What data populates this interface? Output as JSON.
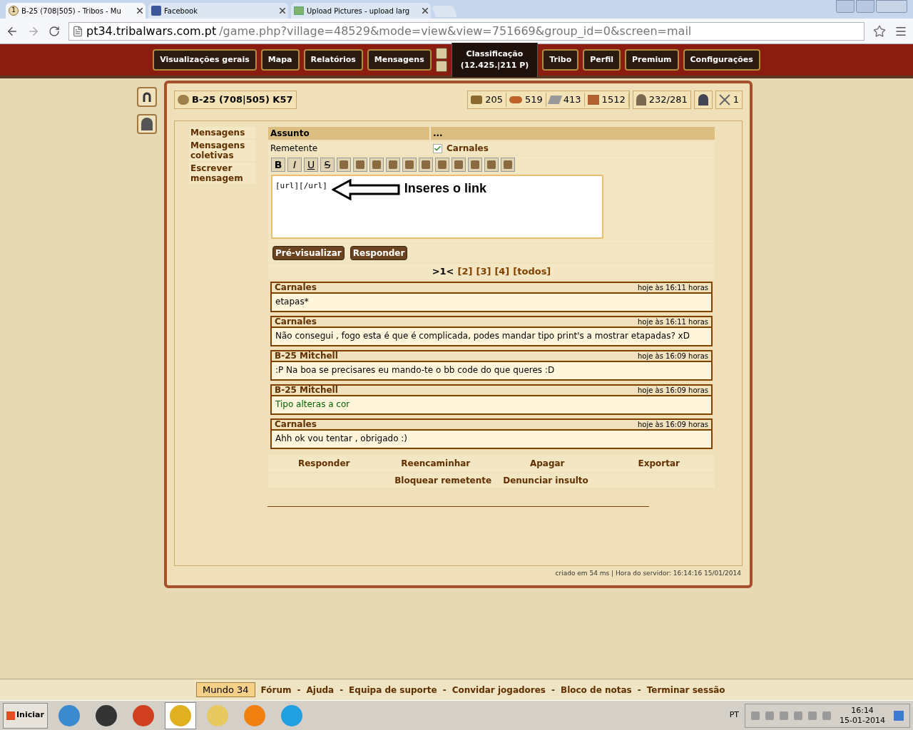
{
  "browser": {
    "tabs": [
      {
        "title": "B-25 (708|505) - Tribos - Mu",
        "favicon_text": "1",
        "selected": true
      },
      {
        "title": "Facebook",
        "selected": false
      },
      {
        "title": "Upload Pictures - upload larg",
        "selected": false
      }
    ],
    "url_host": "pt34.tribalwars.com.pt",
    "url_path": "/game.php?village=48529&mode=view&view=751669&group_id=0&screen=mail"
  },
  "game_nav": {
    "items_left": [
      "Visualizações gerais",
      "Mapa",
      "Relatórios",
      "Mensagens"
    ],
    "ranking": {
      "label": "Classificação",
      "value": "(12.425.|211 P)"
    },
    "items_right": [
      "Tribo",
      "Perfil",
      "Premium",
      "Configurações"
    ]
  },
  "village": {
    "name": "B-25 (708|505) K57"
  },
  "resources": {
    "wood": "205",
    "clay": "519",
    "iron": "413",
    "storage": "1512",
    "population": "232/281",
    "units": "1"
  },
  "sidebar": {
    "items": [
      "Mensagens",
      "Mensagens coletivas",
      "Escrever mensagem"
    ]
  },
  "message_table": {
    "header": [
      "Assunto",
      "..."
    ],
    "sender_label": "Remetente",
    "sender": {
      "name": "Carnales",
      "checked": true
    }
  },
  "editor": {
    "format_buttons": [
      "B",
      "I",
      "U",
      "S"
    ],
    "value": "[url][/url]",
    "annotation": "Inseres o link"
  },
  "buttons": [
    "Pré-visualizar",
    "Responder"
  ],
  "pagination": [
    {
      "label": ">1<",
      "selected": true
    },
    {
      "label": "[2]",
      "selected": false
    },
    {
      "label": "[3]",
      "selected": false
    },
    {
      "label": "[4]",
      "selected": false
    },
    {
      "label": "[todos]",
      "selected": false
    }
  ],
  "messages": [
    {
      "sender": "Carnales",
      "time": "hoje às 16:11 horas",
      "body": "etapas*",
      "color": "#000000"
    },
    {
      "sender": "Carnales",
      "time": "hoje às 16:11 horas",
      "body": "Não consegui , fogo esta é que é complicada, podes mandar tipo print's a mostrar etapadas? xD",
      "color": "#000000"
    },
    {
      "sender": "B-25 Mitchell",
      "time": "hoje às 16:09 horas",
      "body": ":P Na boa se precisares eu mando-te o bb code do que queres :D",
      "color": "#000000"
    },
    {
      "sender": "B-25 Mitchell",
      "time": "hoje às 16:09 horas",
      "body": "Tipo alteras a cor",
      "color": "#006400"
    },
    {
      "sender": "Carnales",
      "time": "hoje às 16:09 horas",
      "body": "Ahh ok vou tentar , obrigado :)",
      "color": "#000000"
    }
  ],
  "actions": [
    [
      "Responder",
      "Reencaminhar",
      "Apagar",
      "Exportar"
    ],
    [
      "Bloquear remetente",
      "Denunciar insulto"
    ]
  ],
  "server_line": "criado em 54 ms | Hora do servidor: 16:14:16 15/01/2014",
  "footer": {
    "world": "Mundo 34",
    "separator": "-",
    "links": [
      "Fórum",
      "Ajuda",
      "Equipa de suporte",
      "Convidar jogadores",
      "Bloco de notas",
      "Terminar sessão"
    ]
  },
  "taskbar": {
    "start": "Iniciar",
    "language": "PT",
    "time": "16:14",
    "date": "15-01-2014"
  }
}
